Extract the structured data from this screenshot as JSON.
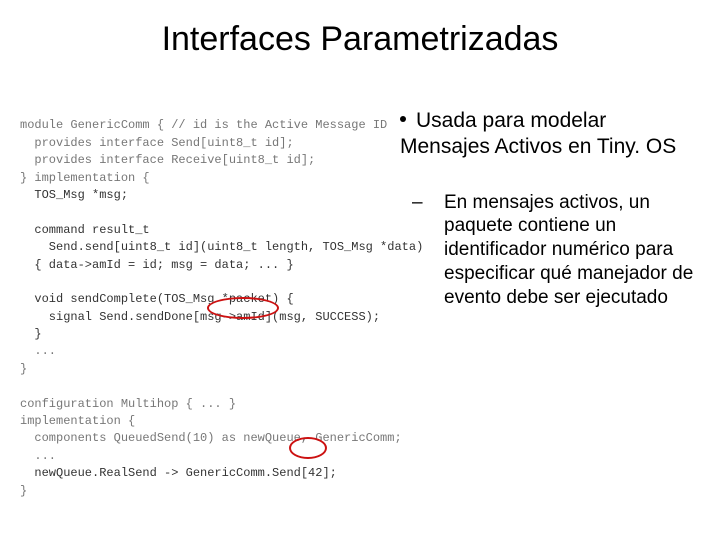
{
  "title": "Interfaces Parametrizadas",
  "code": {
    "l1": "module GenericComm { // id is the Active Message ID",
    "l2": "  provides interface Send[uint8_t id];",
    "l3": "  provides interface Receive[uint8_t id];",
    "l4": "} implementation {",
    "l5": "  TOS_Msg *msg;",
    "l6": "",
    "l7": "  command result_t",
    "l8": "    Send.send[uint8_t id](uint8_t length, TOS_Msg *data)",
    "l9": "  { data->amId = id; msg = data; ... }",
    "l10": "",
    "l11": "  void sendComplete(TOS_Msg *packet) {",
    "l12": "    signal Send.sendDone[msg->amId](msg, SUCCESS);",
    "l13": "  }",
    "l14": "  ...",
    "l15": "}",
    "l16": "",
    "l17": "configuration Multihop { ... }",
    "l18": "implementation {",
    "l19": "  components QueuedSend(10) as newQueue, GenericComm;",
    "l20": "  ...",
    "l21": "  newQueue.RealSend -> GenericComm.Send[42];",
    "l22": "}"
  },
  "bullet_main": "Usada para modelar Mensajes Activos en Tiny. OS",
  "bullet_sub": "En mensajes activos, un paquete contiene un identificador numérico para especificar qué manejador de evento debe ser ejecutado"
}
